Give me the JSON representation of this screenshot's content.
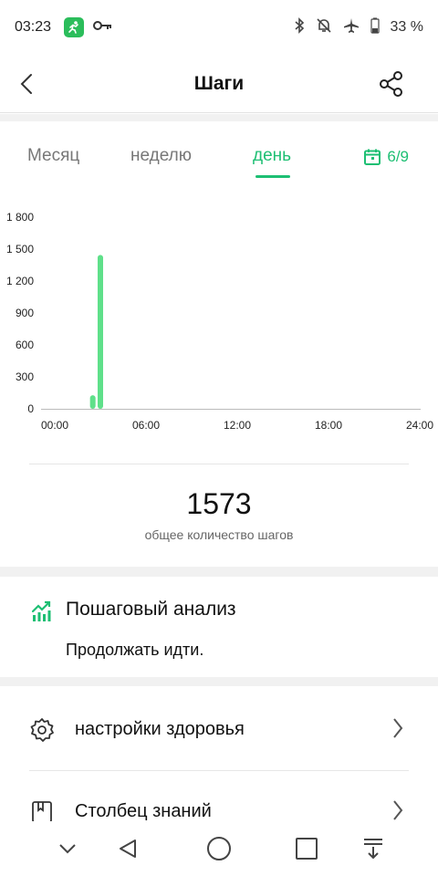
{
  "status_bar": {
    "time": "03:23",
    "battery": "33 %",
    "icons": [
      "fitness-app-icon",
      "key-icon",
      "bluetooth-icon",
      "bell-off-icon",
      "airplane-icon",
      "battery-icon"
    ]
  },
  "header": {
    "title": "Шаги",
    "back_icon": "chevron-left-icon",
    "share_icon": "share-icon"
  },
  "tabs": [
    {
      "label": "Месяц",
      "active": false
    },
    {
      "label": "неделю",
      "active": false
    },
    {
      "label": "день",
      "active": true
    }
  ],
  "date_picker": {
    "label": "6/9",
    "icon": "calendar-icon"
  },
  "accent_color": "#1dbf73",
  "chart_data": {
    "type": "bar",
    "x_ticks": [
      "00:00",
      "06:00",
      "12:00",
      "18:00",
      "24:00"
    ],
    "y_ticks": [
      "0",
      "300",
      "600",
      "900",
      "1 200",
      "1 500",
      "1 800"
    ],
    "ylim": [
      0,
      1800
    ],
    "xlim": [
      0,
      24
    ],
    "bar_color": "#5fe08a",
    "bars": [
      {
        "hour": 2.5,
        "value": 128
      },
      {
        "hour": 3.0,
        "value": 1445
      }
    ]
  },
  "summary": {
    "total_steps": "1573",
    "caption": "общее количество шагов"
  },
  "analysis": {
    "title": "Пошаговый анализ",
    "text": "Продолжать идти.",
    "icon": "chart-trend-icon"
  },
  "settings": [
    {
      "label": "настройки здоровья",
      "icon": "gear-icon"
    },
    {
      "label": "Столбец знаний",
      "icon": "book-icon"
    }
  ],
  "nav_bar": {
    "icons": [
      "collapse-icon",
      "back-triangle-icon",
      "home-circle-icon",
      "recents-square-icon",
      "notification-pull-icon"
    ]
  }
}
